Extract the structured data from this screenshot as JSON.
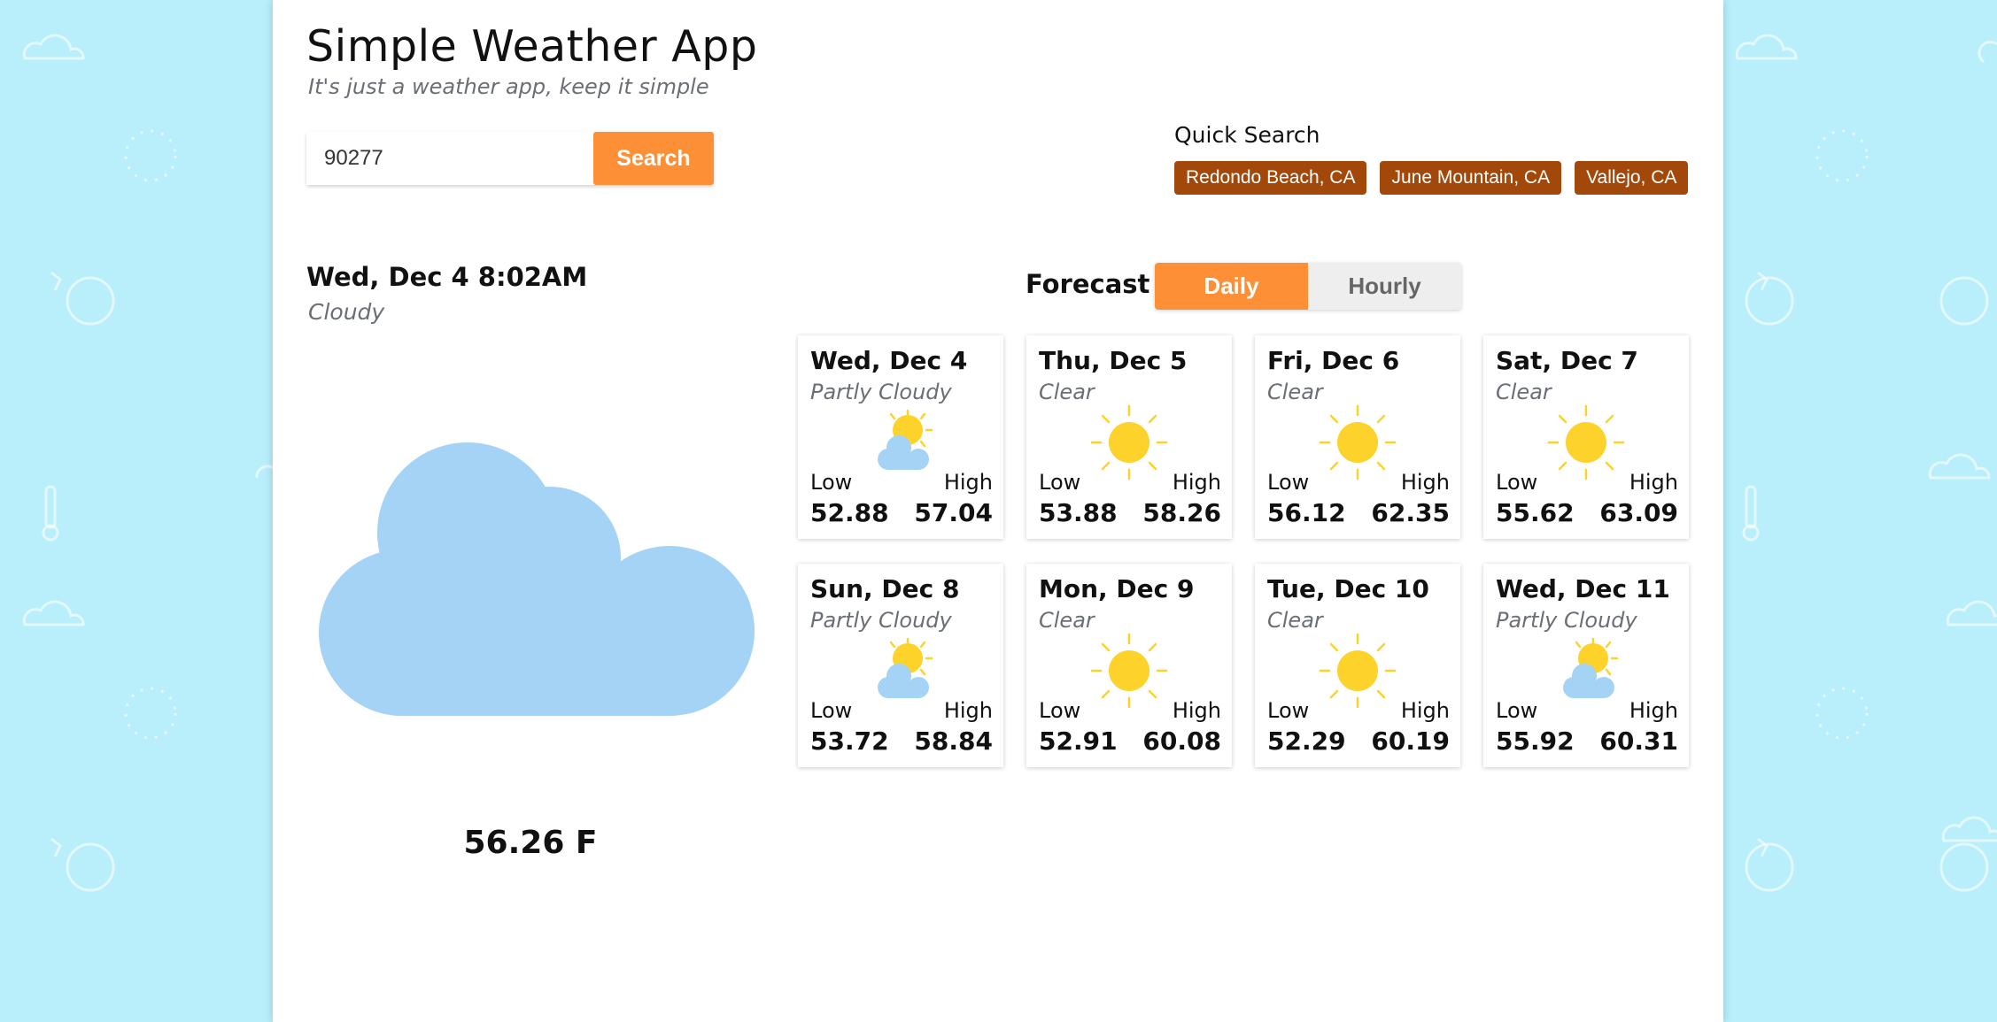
{
  "app": {
    "title": "Simple Weather App",
    "subtitle": "It's just a weather app, keep it simple"
  },
  "search": {
    "value": "90277",
    "button_label": "Search"
  },
  "quick_search": {
    "label": "Quick Search",
    "locations": [
      "Redondo Beach, CA",
      "June Mountain, CA",
      "Vallejo, CA"
    ]
  },
  "current": {
    "datetime": "Wed, Dec 4 8:02AM",
    "condition": "Cloudy",
    "icon": "cloud-icon",
    "temperature": "56.26 F"
  },
  "forecast": {
    "label": "Forecast",
    "toggle": {
      "daily": "Daily",
      "hourly": "Hourly",
      "selected": "Daily"
    },
    "low_label": "Low",
    "high_label": "High",
    "days": [
      {
        "day": "Wed, Dec 4",
        "condition": "Partly Cloudy",
        "icon": "partly-cloudy-icon",
        "low": "52.88",
        "high": "57.04"
      },
      {
        "day": "Thu, Dec 5",
        "condition": "Clear",
        "icon": "sun-icon",
        "low": "53.88",
        "high": "58.26"
      },
      {
        "day": "Fri, Dec 6",
        "condition": "Clear",
        "icon": "sun-icon",
        "low": "56.12",
        "high": "62.35"
      },
      {
        "day": "Sat, Dec 7",
        "condition": "Clear",
        "icon": "sun-icon",
        "low": "55.62",
        "high": "63.09"
      },
      {
        "day": "Sun, Dec 8",
        "condition": "Partly Cloudy",
        "icon": "partly-cloudy-icon",
        "low": "53.72",
        "high": "58.84"
      },
      {
        "day": "Mon, Dec 9",
        "condition": "Clear",
        "icon": "sun-icon",
        "low": "52.91",
        "high": "60.08"
      },
      {
        "day": "Tue, Dec 10",
        "condition": "Clear",
        "icon": "sun-icon",
        "low": "52.29",
        "high": "60.19"
      },
      {
        "day": "Wed, Dec 11",
        "condition": "Partly Cloudy",
        "icon": "partly-cloudy-icon",
        "low": "55.92",
        "high": "60.31"
      }
    ]
  },
  "colors": {
    "background": "#b9eefb",
    "accent": "#fd8f36",
    "chip": "#a2480a",
    "cloud": "#a5d3f5",
    "sun": "#fdd22b"
  }
}
